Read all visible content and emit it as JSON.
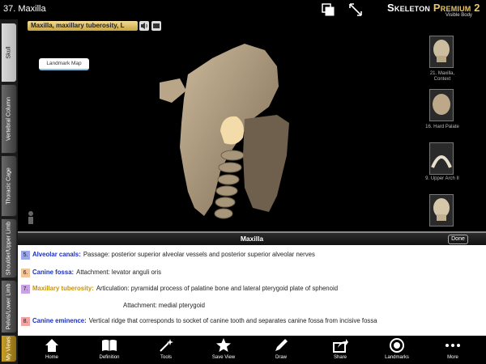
{
  "header": {
    "title": "37. Maxilla",
    "brand_a": "Skeleton",
    "brand_b": "Premium 2",
    "brand_sub": "Visible Body"
  },
  "sidetabs": [
    {
      "label": "Skull"
    },
    {
      "label": "Vertebral Column"
    },
    {
      "label": "Thoracic Cage"
    },
    {
      "label": "Shoulder/Upper Limb"
    },
    {
      "label": "Pelvis/Lower Limb"
    },
    {
      "label": "My Views"
    }
  ],
  "viewport": {
    "structure_label": "Maxilla, maxillary tuberosity, L",
    "landmark_button": "Landmark Map"
  },
  "thumbnails": [
    {
      "label": "21. Maxilla, Context"
    },
    {
      "label": "16. Hard Palate"
    },
    {
      "label": "9. Upper Arch II"
    }
  ],
  "panel": {
    "title": "Maxilla",
    "done_label": "Done",
    "entries": [
      {
        "num": "5.",
        "name": "Alveolar canals:",
        "text": "Passage: posterior superior alveolar vessels and posterior superior alveolar nerves",
        "color": "#1a2fc8",
        "badge": "#9aa6e8"
      },
      {
        "num": "6.",
        "name": "Canine fossa:",
        "text": "Attachment: levator anguli oris",
        "color": "#1a2fc8",
        "badge": "#f3c69a"
      },
      {
        "num": "7.",
        "name": "Maxillary tuberosity:",
        "text": "Articulation: pyramidal process of palatine bone and lateral pterygoid plate of sphenoid",
        "color": "#c79410",
        "badge": "#c9a3e6"
      },
      {
        "num": "8.",
        "name": "Canine eminence:",
        "text": "Vertical ridge that corresponds to socket of canine tooth and separates canine fossa from incisive fossa",
        "color": "#1a2fc8",
        "badge": "#f2a3a3"
      }
    ],
    "sub_entry": "Attachment: medial pterygoid"
  },
  "toolbar": {
    "items": [
      {
        "label": "Home",
        "icon": "home-icon"
      },
      {
        "label": "Definition",
        "icon": "book-icon"
      },
      {
        "label": "Tools",
        "icon": "wand-icon"
      },
      {
        "label": "Save View",
        "icon": "star-icon"
      },
      {
        "label": "Draw",
        "icon": "pencil-icon"
      },
      {
        "label": "Share",
        "icon": "share-icon"
      },
      {
        "label": "Landmarks",
        "icon": "target-icon"
      },
      {
        "label": "More",
        "icon": "dots-icon"
      }
    ]
  }
}
